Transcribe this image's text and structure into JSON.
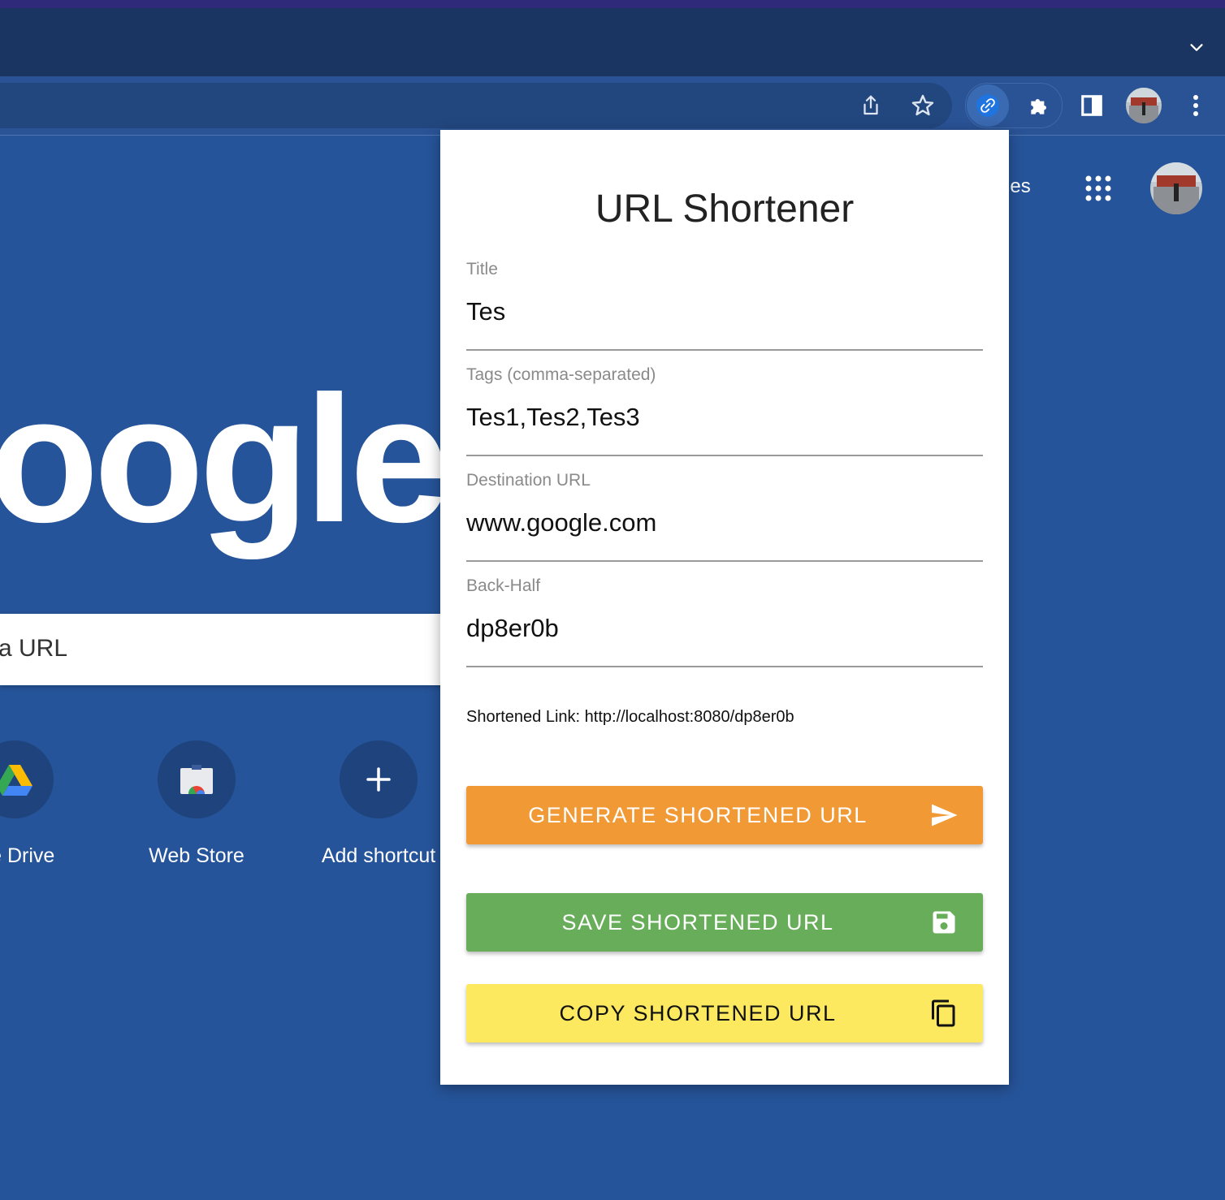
{
  "browser": {
    "images_link_partial": "ges"
  },
  "newtab": {
    "logo_partial": "oogle",
    "search_placeholder_partial": "a URL",
    "shortcuts": [
      {
        "label": "gle Drive",
        "icon": "google-drive-icon"
      },
      {
        "label": "Web Store",
        "icon": "web-store-icon"
      },
      {
        "label": "Add shortcut",
        "icon": "plus-icon"
      }
    ]
  },
  "popup": {
    "title": "URL Shortener",
    "fields": [
      {
        "label": "Title",
        "value": "Tes"
      },
      {
        "label": "Tags (comma-separated)",
        "value": "Tes1,Tes2,Tes3"
      },
      {
        "label": "Destination URL",
        "value": "www.google.com"
      },
      {
        "label": "Back-Half",
        "value": "dp8er0b"
      }
    ],
    "shortened_link": "Shortened Link: http://localhost:8080/dp8er0b",
    "buttons": {
      "generate": {
        "label": "GENERATE SHORTENED URL",
        "color": "#f19a35",
        "icon": "send-icon"
      },
      "save": {
        "label": "SAVE SHORTENED URL",
        "color": "#68ad5a",
        "icon": "save-icon"
      },
      "copy": {
        "label": "COPY SHORTENED URL",
        "color": "#fce960",
        "icon": "copy-icon"
      }
    }
  }
}
